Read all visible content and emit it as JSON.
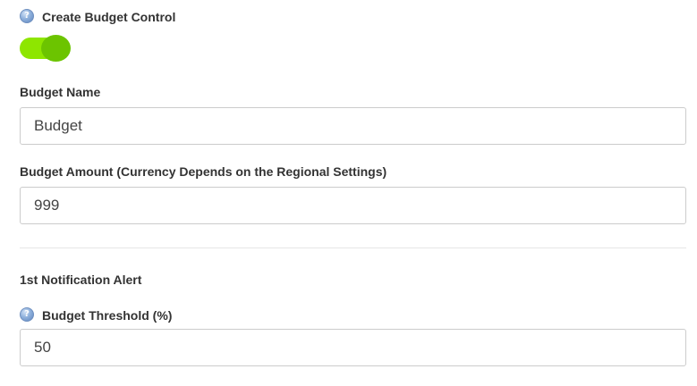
{
  "budget_control": {
    "label": "Create Budget Control",
    "help_icon_text": "?",
    "enabled": true
  },
  "budget_name": {
    "label": "Budget Name",
    "value": "Budget"
  },
  "budget_amount": {
    "label": "Budget Amount (Currency Depends on the Regional Settings)",
    "value": "999"
  },
  "notification": {
    "section_title": "1st Notification Alert",
    "threshold_label": "Budget Threshold (%)",
    "help_icon_text": "?",
    "threshold_value": "50"
  },
  "colors": {
    "toggle_track": "#8ee600",
    "toggle_knob": "#6cc400",
    "input_border": "#cccccc",
    "divider": "#e6e6e6"
  }
}
